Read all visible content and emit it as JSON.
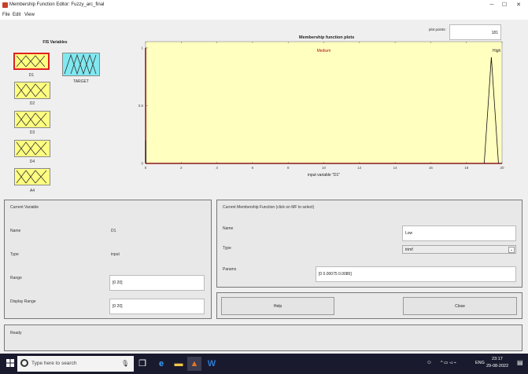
{
  "window": {
    "title": "Membership Function Editor: Fuzzy_arc_final",
    "minimize": "─",
    "maximize": "☐",
    "close": "✕"
  },
  "menu": [
    "File",
    "Edit",
    "View"
  ],
  "fis": {
    "heading": "FIS Variables",
    "inputs": [
      "D1",
      "D2",
      "D3",
      "D4",
      "A4"
    ],
    "output": "TARGET"
  },
  "plot": {
    "title": "Membership function plots",
    "points_label": "plot points:",
    "points_value": "181"
  },
  "chart_data": {
    "type": "line",
    "title": "Membership function plots",
    "xlabel": "input variable \"D1\"",
    "ylabel": "",
    "xlim": [
      0,
      20
    ],
    "ylim": [
      0,
      1
    ],
    "x_ticks": [
      "0",
      "2",
      "4",
      "6",
      "8",
      "10",
      "12",
      "14",
      "16",
      "18",
      "20"
    ],
    "y_ticks": [
      "0",
      "0.5",
      "1"
    ],
    "series": [
      {
        "name": "Low",
        "color": "#8b1a1a",
        "x": [
          0,
          0.00075,
          0.008
        ],
        "y": [
          1,
          1,
          0
        ],
        "label_x": 0,
        "label_y": 1
      },
      {
        "name": "Medium",
        "color": "#111111",
        "x": [
          0,
          0.00075,
          0.008
        ],
        "y": [
          0,
          0.2,
          0
        ],
        "label_x": 10,
        "label_y": 1
      },
      {
        "name": "High",
        "color": "#111111",
        "x": [
          19,
          19.4,
          19.8
        ],
        "y": [
          0,
          0.92,
          0
        ],
        "label_x": 19.7,
        "label_y": 1
      }
    ],
    "labels_shown": [
      "Medium",
      "High"
    ]
  },
  "current_variable": {
    "heading": "Current Variable",
    "name_label": "Name",
    "name_value": "D1",
    "type_label": "Type",
    "type_value": "input",
    "range_label": "Range",
    "range_value": "[0 20]",
    "display_range_label": "Display Range",
    "display_range_value": "[0 20]"
  },
  "current_mf": {
    "heading": "Current Membership Function (click on MF to select)",
    "name_label": "Name",
    "name_value": "Low",
    "type_label": "Type",
    "type_value": "trimf",
    "params_label": "Params",
    "params_value": "[0 0.00075 0.0080]"
  },
  "buttons": {
    "help": "Help",
    "close": "Close"
  },
  "status": "Ready",
  "taskbar": {
    "search_placeholder": "Type here to search",
    "lang": "ENG",
    "time": "23:17",
    "date": "29-08-2022"
  },
  "colors": {
    "plot_bg": "#ffffc0",
    "input_var": "#ffff80",
    "output_var": "#80e8f0",
    "selected_border": "#e02020"
  }
}
